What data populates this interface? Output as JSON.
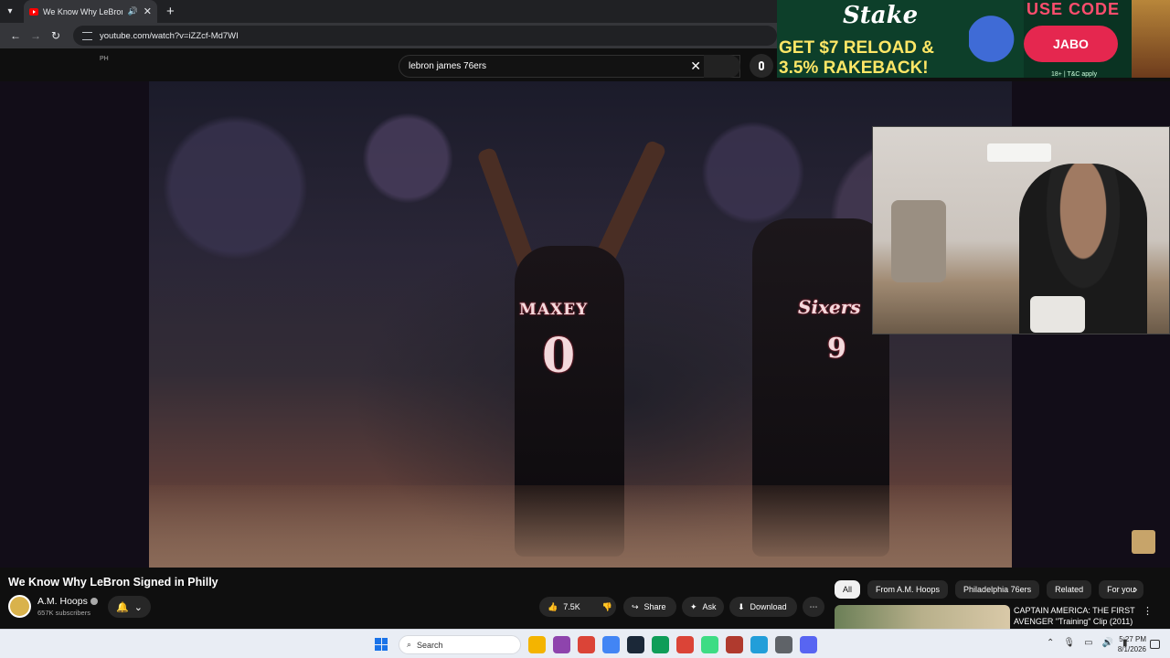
{
  "browser": {
    "tab_title": "We Know Why LeBron Signed in Philly",
    "url": "youtube.com/watch?v=iZZcf-Md7WI"
  },
  "youtube": {
    "country_code": "PH",
    "search_query": "lebron james 76ers",
    "video": {
      "jersey_1_name": "MAXEY",
      "jersey_1_number": "0",
      "jersey_2_name": "Sixers",
      "jersey_2_number": "9"
    },
    "title": "We Know Why LeBron Signed in Philly",
    "channel": {
      "name": "A.M. Hoops",
      "subscribers": "657K subscribers"
    },
    "actions": {
      "likes": "7.5K",
      "share": "Share",
      "ask": "Ask",
      "download": "Download"
    },
    "chips": [
      "All",
      "From A.M. Hoops",
      "Philadelphia 76ers",
      "Related",
      "For you"
    ],
    "recommendation": {
      "title": "CAPTAIN AMERICA: THE FIRST AVENGER \"Training\" Clip (2011)"
    }
  },
  "ad": {
    "brand": "Stake",
    "headline": "GET $7 RELOAD &\n3.5% RAKEBACK!",
    "use_code": "USE CODE",
    "code": "JABO",
    "fine_print": "18+ | T&C apply"
  },
  "taskbar": {
    "search_placeholder": "Search",
    "time": "5:27 PM",
    "date": "8/1/2026",
    "icon_colors": [
      "#f4b400",
      "#8e44ad",
      "#db4437",
      "#4285f4",
      "#1b2838",
      "#0f9d58",
      "#db4437",
      "#3ddc84",
      "#b03a2e",
      "#229ed9",
      "#5f6368",
      "#5865f2"
    ]
  }
}
